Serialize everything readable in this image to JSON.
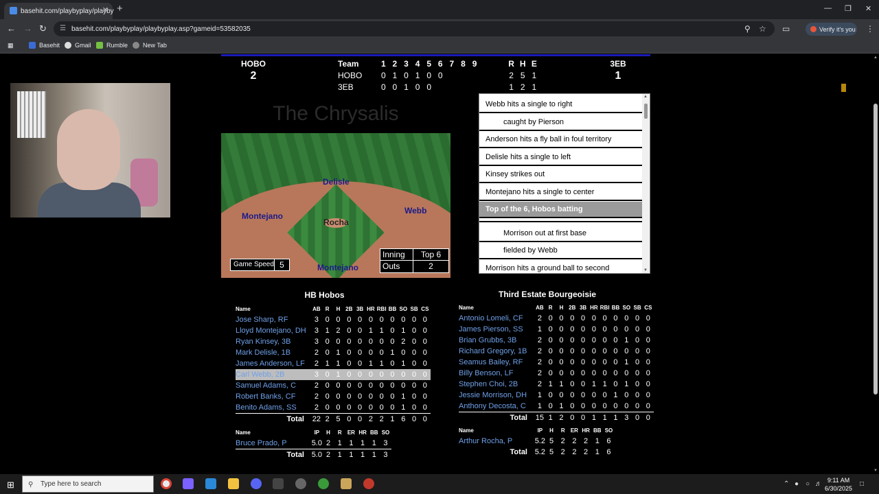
{
  "browser": {
    "tab_title": "basehit.com/playbyplay/playby",
    "tab_close": "✕",
    "new_tab": "+",
    "url": "basehit.com/playbyplay/playbyplay.asp?gameid=53582035",
    "verify_label": "Verify it's you",
    "bookmarks": [
      "Basehit",
      "Gmail",
      "Rumble",
      "New Tab"
    ]
  },
  "scoreboard": {
    "away_abbr": "HOBO",
    "away_runs": "2",
    "home_abbr": "3EB",
    "home_runs": "1",
    "header": {
      "team": "Team",
      "innings": [
        "1",
        "2",
        "3",
        "4",
        "5",
        "6",
        "7",
        "8",
        "9"
      ],
      "rhe": [
        "R",
        "H",
        "E"
      ]
    },
    "lines": [
      {
        "team": "HOBO",
        "innings": [
          "0",
          "1",
          "0",
          "1",
          "0",
          "0",
          "",
          "",
          ""
        ],
        "rhe": [
          "2",
          "5",
          "1"
        ]
      },
      {
        "team": "3EB",
        "innings": [
          "0",
          "0",
          "1",
          "0",
          "0",
          "",
          "",
          "",
          ""
        ],
        "rhe": [
          "1",
          "2",
          "1"
        ]
      }
    ]
  },
  "ballpark": "The Chrysalis",
  "field": {
    "fielders": {
      "second": "Delisle",
      "first": "Webb",
      "third": "Montejano",
      "pitcher": "Rocha",
      "batter": "Montejano"
    },
    "game_speed_label": "Game Speed",
    "game_speed": "5",
    "inning_label": "Inning",
    "inning": "Top 6",
    "outs_label": "Outs",
    "outs": "2"
  },
  "play_by_play": [
    {
      "text": "Webb hits a single to right",
      "indent": false,
      "highlight": false
    },
    {
      "text": "caught by Pierson",
      "indent": true,
      "highlight": false
    },
    {
      "text": "Anderson hits a fly ball in foul territory",
      "indent": false,
      "highlight": false
    },
    {
      "text": "Delisle hits a single to left",
      "indent": false,
      "highlight": false
    },
    {
      "text": "Kinsey strikes out",
      "indent": false,
      "highlight": false
    },
    {
      "text": "Montejano hits a single to center",
      "indent": false,
      "highlight": false
    },
    {
      "text": "Top of the 6, Hobos batting",
      "indent": false,
      "highlight": true
    },
    {
      "text": "",
      "indent": false,
      "highlight": false
    },
    {
      "text": "Morrison out at first base",
      "indent": true,
      "highlight": false
    },
    {
      "text": "fielded by Webb",
      "indent": true,
      "highlight": false
    },
    {
      "text": "Morrison hits a ground ball to second",
      "indent": false,
      "highlight": false
    }
  ],
  "away_box": {
    "team_name": "HB Hobos",
    "batting_headers": [
      "Name",
      "AB",
      "R",
      "H",
      "2B",
      "3B",
      "HR",
      "RBI",
      "BB",
      "SO",
      "SB",
      "CS"
    ],
    "batters": [
      [
        "Jose Sharp, RF",
        "3",
        "0",
        "0",
        "0",
        "0",
        "0",
        "0",
        "0",
        "0",
        "0",
        "0"
      ],
      [
        "Lloyd Montejano, DH",
        "3",
        "1",
        "2",
        "0",
        "0",
        "1",
        "1",
        "0",
        "1",
        "0",
        "0"
      ],
      [
        "Ryan Kinsey, 3B",
        "3",
        "0",
        "0",
        "0",
        "0",
        "0",
        "0",
        "0",
        "2",
        "0",
        "0"
      ],
      [
        "Mark Delisle, 1B",
        "2",
        "0",
        "1",
        "0",
        "0",
        "0",
        "0",
        "1",
        "0",
        "0",
        "0"
      ],
      [
        "James Anderson, LF",
        "2",
        "1",
        "1",
        "0",
        "0",
        "1",
        "1",
        "0",
        "1",
        "0",
        "0"
      ],
      [
        "Carl Webb, 2B",
        "3",
        "0",
        "1",
        "0",
        "0",
        "0",
        "0",
        "0",
        "0",
        "0",
        "0"
      ],
      [
        "Samuel Adams, C",
        "2",
        "0",
        "0",
        "0",
        "0",
        "0",
        "0",
        "0",
        "0",
        "0",
        "0"
      ],
      [
        "Robert Banks, CF",
        "2",
        "0",
        "0",
        "0",
        "0",
        "0",
        "0",
        "0",
        "1",
        "0",
        "0"
      ],
      [
        "Benito Adams, SS",
        "2",
        "0",
        "0",
        "0",
        "0",
        "0",
        "0",
        "0",
        "1",
        "0",
        "0"
      ]
    ],
    "selected_row": 5,
    "batting_total": [
      "Total",
      "22",
      "2",
      "5",
      "0",
      "0",
      "2",
      "2",
      "1",
      "6",
      "0",
      "0"
    ],
    "pitching_headers": [
      "Name",
      "IP",
      "H",
      "R",
      "ER",
      "HR",
      "BB",
      "SO"
    ],
    "pitchers": [
      [
        "Bruce Prado, P",
        "5.0",
        "2",
        "1",
        "1",
        "1",
        "1",
        "3"
      ]
    ],
    "pitching_total": [
      "Total",
      "5.0",
      "2",
      "1",
      "1",
      "1",
      "1",
      "3"
    ]
  },
  "home_box": {
    "team_name": "Third Estate Bourgeoisie",
    "batting_headers": [
      "Name",
      "AB",
      "R",
      "H",
      "2B",
      "3B",
      "HR",
      "RBI",
      "BB",
      "SO",
      "SB",
      "CS"
    ],
    "batters": [
      [
        "Antonio Lomeli, CF",
        "2",
        "0",
        "0",
        "0",
        "0",
        "0",
        "0",
        "0",
        "0",
        "0",
        "0"
      ],
      [
        "James Pierson, SS",
        "1",
        "0",
        "0",
        "0",
        "0",
        "0",
        "0",
        "0",
        "0",
        "0",
        "0"
      ],
      [
        "Brian Grubbs, 3B",
        "2",
        "0",
        "0",
        "0",
        "0",
        "0",
        "0",
        "0",
        "1",
        "0",
        "0"
      ],
      [
        "Richard Gregory, 1B",
        "2",
        "0",
        "0",
        "0",
        "0",
        "0",
        "0",
        "0",
        "0",
        "0",
        "0"
      ],
      [
        "Seamus Bailey, RF",
        "2",
        "0",
        "0",
        "0",
        "0",
        "0",
        "0",
        "0",
        "1",
        "0",
        "0"
      ],
      [
        "Billy Benson, LF",
        "2",
        "0",
        "0",
        "0",
        "0",
        "0",
        "0",
        "0",
        "0",
        "0",
        "0"
      ],
      [
        "Stephen Choi, 2B",
        "2",
        "1",
        "1",
        "0",
        "0",
        "1",
        "1",
        "0",
        "1",
        "0",
        "0"
      ],
      [
        "Jessie Morrison, DH",
        "1",
        "0",
        "0",
        "0",
        "0",
        "0",
        "0",
        "1",
        "0",
        "0",
        "0"
      ],
      [
        "Anthony Decosta, C",
        "1",
        "0",
        "1",
        "0",
        "0",
        "0",
        "0",
        "0",
        "0",
        "0",
        "0"
      ]
    ],
    "batting_total": [
      "Total",
      "15",
      "1",
      "2",
      "0",
      "0",
      "1",
      "1",
      "1",
      "3",
      "0",
      "0"
    ],
    "pitching_headers": [
      "Name",
      "IP",
      "H",
      "R",
      "ER",
      "HR",
      "BB",
      "SO"
    ],
    "pitchers": [
      [
        "Arthur Rocha, P",
        "5.2",
        "5",
        "2",
        "2",
        "2",
        "1",
        "6"
      ]
    ],
    "pitching_total": [
      "Total",
      "5.2",
      "5",
      "2",
      "2",
      "2",
      "1",
      "6"
    ]
  },
  "taskbar": {
    "search_placeholder": "Type here to search",
    "time": "9:11 AM",
    "date": "6/30/2025"
  }
}
